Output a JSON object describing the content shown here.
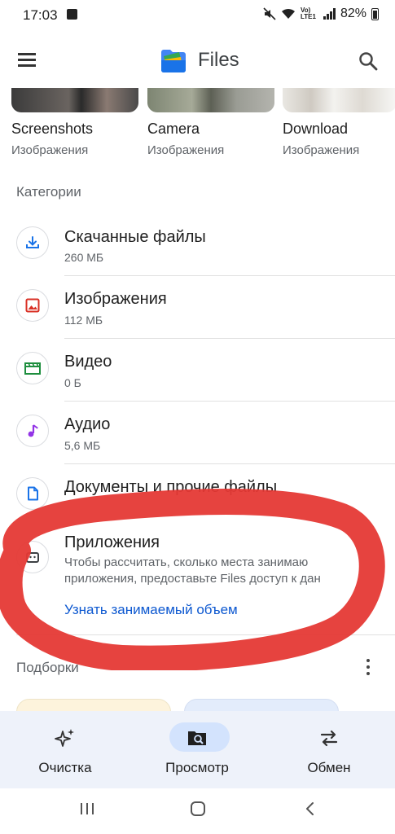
{
  "status_bar": {
    "time": "17:03",
    "network_label": "Vo) LTE1",
    "battery": "82%",
    "icons": [
      "image-icon",
      "mute-icon",
      "wifi-icon",
      "signal-icon",
      "battery-icon"
    ]
  },
  "app_bar": {
    "title": "Files",
    "menu_icon": "menu-icon",
    "search_icon": "search-icon"
  },
  "folders": [
    {
      "name": "Screenshots",
      "subtitle": "Изображения"
    },
    {
      "name": "Camera",
      "subtitle": "Изображения"
    },
    {
      "name": "Download",
      "subtitle": "Изображения"
    }
  ],
  "categories": {
    "title": "Категории",
    "items": [
      {
        "label": "Скачанные файлы",
        "size": "260 МБ",
        "icon": "download-icon",
        "color": "#1a73e8"
      },
      {
        "label": "Изображения",
        "size": "112 МБ",
        "icon": "image-icon",
        "color": "#d93025"
      },
      {
        "label": "Видео",
        "size": "0 Б",
        "icon": "video-icon",
        "color": "#1e8e3e"
      },
      {
        "label": "Аудио",
        "size": "5,6 МБ",
        "icon": "music-note-icon",
        "color": "#9334e6"
      },
      {
        "label": "Документы и прочие файлы",
        "size": "",
        "icon": "document-icon",
        "color": "#1a73e8"
      }
    ],
    "apps": {
      "label": "Приложения",
      "description_line1": "Чтобы рассчитать, сколько места занимаю",
      "description_line2": "приложения, предоставьте Files доступ к дан",
      "link": "Узнать занимаемый объем",
      "icon": "android-icon"
    }
  },
  "collections": {
    "title": "Подборки"
  },
  "bottom_nav": {
    "items": [
      {
        "label": "Очистка",
        "icon": "sparkle-icon",
        "active": false
      },
      {
        "label": "Просмотр",
        "icon": "browse-folder-icon",
        "active": true
      },
      {
        "label": "Обмен",
        "icon": "swap-arrows-icon",
        "active": false
      }
    ]
  },
  "colors": {
    "accent": "#0b57d0",
    "nav_background": "#eef2fa",
    "active_pill": "#d3e3fd",
    "annotation": "#e53935"
  }
}
